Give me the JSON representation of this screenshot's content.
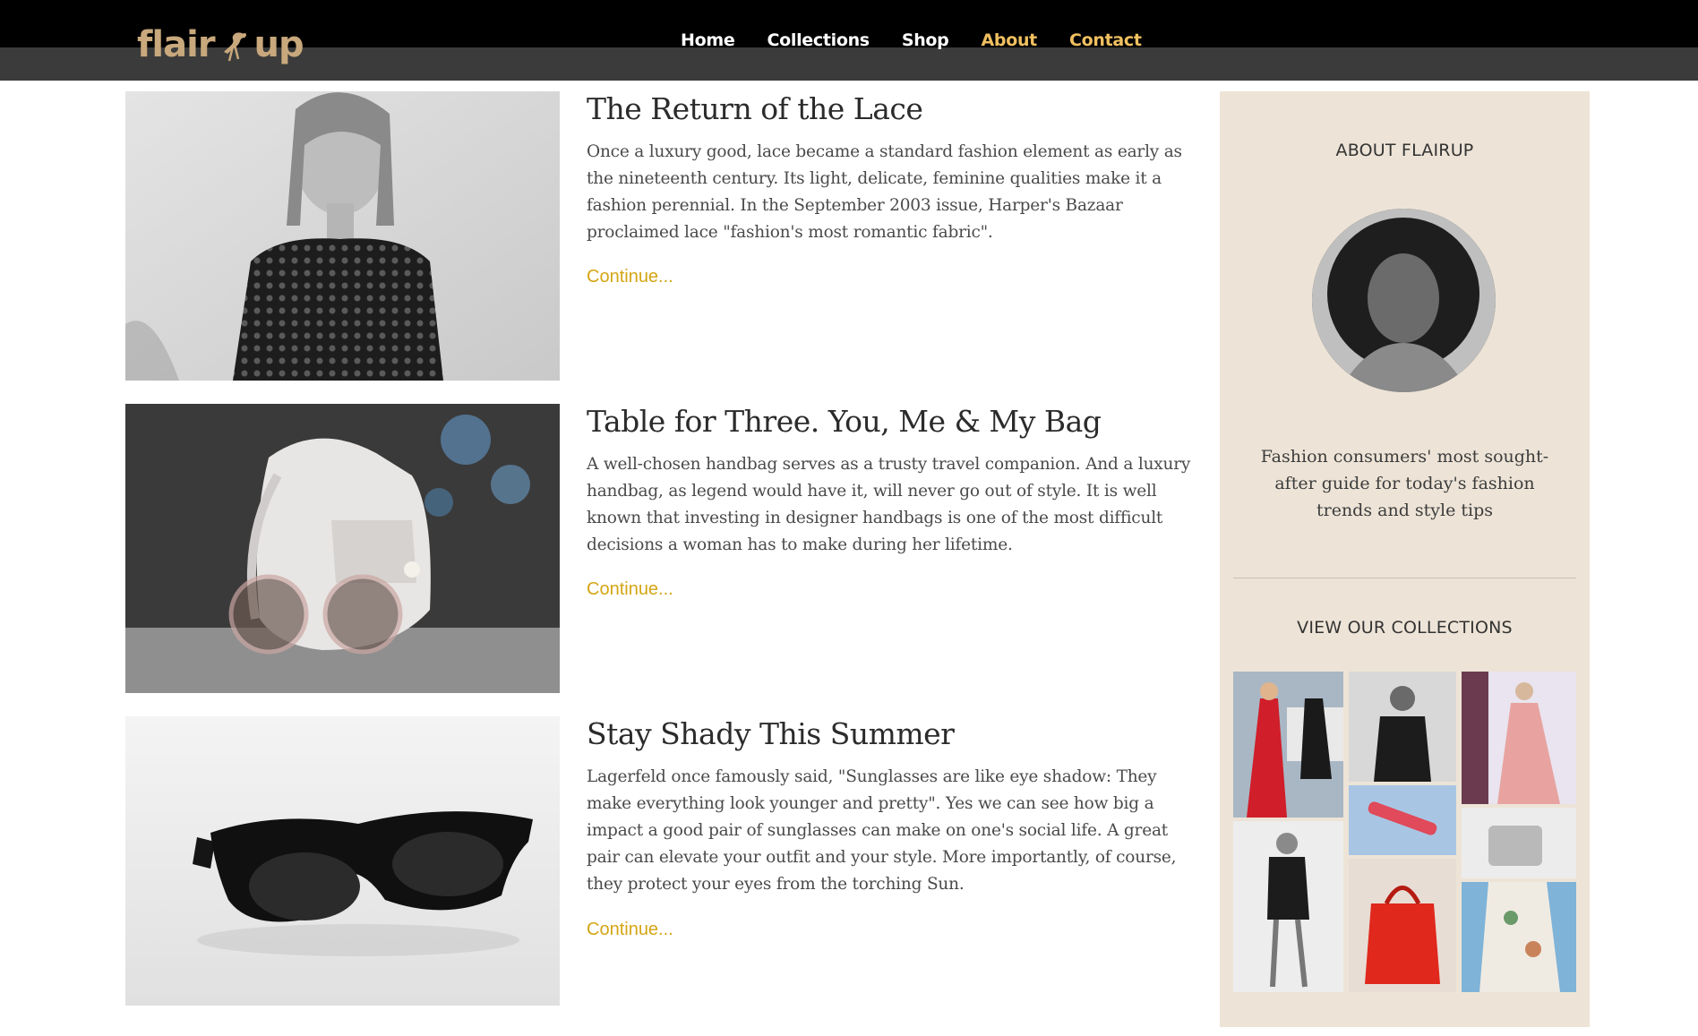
{
  "brand": {
    "logo_part1": "flair",
    "logo_part2": "up",
    "logo_color": "#c8a87c"
  },
  "nav": {
    "items": [
      {
        "label": "Home",
        "active": false
      },
      {
        "label": "Collections",
        "active": false
      },
      {
        "label": "Shop",
        "active": false
      },
      {
        "label": "About",
        "active": true
      },
      {
        "label": "Contact",
        "active": true
      }
    ],
    "active_color": "#f0c060"
  },
  "posts": [
    {
      "title": "The Return of the Lace",
      "excerpt": "Once a luxury good, lace became a standard fashion element as early as the nineteenth century. Its light, delicate, feminine qualities make it a fashion perennial. In the September 2003 issue, Harper's Bazaar proclaimed lace \"fashion's most romantic fabric\".",
      "continue": "Continue...",
      "image_icon": "lace-dress-photo"
    },
    {
      "title": "Table for Three. You, Me & My Bag",
      "excerpt": "A well-chosen handbag serves as a trusty travel companion. And a luxury handbag, as legend would have it, will never go out of style. It is well known that investing in designer handbags is one of the most difficult decisions a woman has to make during her lifetime.",
      "continue": "Continue...",
      "image_icon": "handbag-photo"
    },
    {
      "title": "Stay Shady This Summer",
      "excerpt": "Lagerfeld once famously said, \"Sunglasses are like eye shadow: They make everything look younger and pretty\". Yes we can see how big a impact a good pair of sunglasses can make on one's social life. A great pair can elevate your outfit and your style. More importantly, of course, they protect your eyes from the torching Sun.",
      "continue": "Continue...",
      "image_icon": "sunglasses-photo"
    }
  ],
  "sidebar": {
    "about_heading": "ABOUT FLAIRUP",
    "about_text": "Fashion consumers' most sought-after guide for today's fashion trends and style tips",
    "collections_heading": "VIEW OUR COLLECTIONS",
    "background": "#ede4d7"
  },
  "colors": {
    "continue_link": "#d4a514",
    "header_bg": "#000000",
    "subheader_bg": "#3b3b3b"
  }
}
